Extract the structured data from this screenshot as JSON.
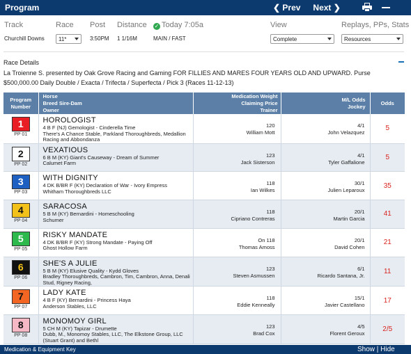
{
  "header": {
    "title": "Program",
    "prev": "❮ Prev",
    "next": "Next ❯",
    "print_icon": "printer-icon",
    "minimize_icon": "minus-icon"
  },
  "info": {
    "labels": {
      "track": "Track",
      "race": "Race",
      "post": "Post",
      "distance": "Distance",
      "today": "Today 7:05a",
      "view": "View",
      "replays": "Replays, PPs, Stats"
    },
    "track_value": "Churchill Downs",
    "race_value": "11*",
    "post_value": "3:50PM",
    "distance_value": "1 1/16M",
    "surface_value": "MAIN / FAST",
    "view_value": "Complete",
    "resources_value": "Resources"
  },
  "race_details": {
    "label": "Race Details",
    "description": "La Troienne S. presented by Oak Grove Racing and Gaming FOR FILLIES AND MARES FOUR YEARS OLD AND UPWARD. Purse $500,000.00 Daily Double / Exacta / Trifecta / Superfecta / Pick 3 (Races 11-12-13)"
  },
  "table": {
    "headers": {
      "program": [
        "Program",
        "Number"
      ],
      "horse": [
        "Horse",
        "Breed Sire-Dam",
        "Owner"
      ],
      "med": [
        "Medication Weight",
        "Claiming Price",
        "Trainer"
      ],
      "ml": [
        "M/L Odds",
        "Jockey"
      ],
      "odds": "Odds"
    },
    "rows": [
      {
        "num": "1",
        "pp": "PP 01",
        "bg": "#e81e24",
        "fg": "#ffffff",
        "name": "HOROLOGIST",
        "breed": "4 B F (NJ) Gemologist - Cinderella Time",
        "owner": "There's A Chance Stable, Parkland Thoroughbreds, Medallion Racing and Abbondanza",
        "med": "",
        "weight": "120",
        "trainer": "William Mott",
        "ml": "4/1",
        "jockey": "John Velazquez",
        "odds": "5"
      },
      {
        "num": "2",
        "pp": "PP 02",
        "bg": "#ffffff",
        "fg": "#111111",
        "name": "VEXATIOUS",
        "breed": "6 B M (KY) Giant's Causeway - Dream of Summer",
        "owner": "Calumet Farm",
        "med": "",
        "weight": "123",
        "trainer": "Jack Sisterson",
        "ml": "4/1",
        "jockey": "Tyler Gaffalione",
        "odds": "5"
      },
      {
        "num": "3",
        "pp": "PP 03",
        "bg": "#1e5fc2",
        "fg": "#ffffff",
        "name": "WITH DIGNITY",
        "breed": "4 DK B/BR F (KY) Declaration of War - Ivory Empress",
        "owner": "Whitham Thoroughbreds LLC",
        "med": "",
        "weight": "118",
        "trainer": "Ian Wilkes",
        "ml": "30/1",
        "jockey": "Julien Leparoux",
        "odds": "35"
      },
      {
        "num": "4",
        "pp": "PP 04",
        "bg": "#f3c21a",
        "fg": "#111111",
        "name": "SARACOSA",
        "breed": "5 B M (KY) Bernardini - Homeschooling",
        "owner": "Schumer",
        "med": "",
        "weight": "118",
        "trainer": "Cipriano Contreras",
        "ml": "20/1",
        "jockey": "Martin Garcia",
        "odds": "41"
      },
      {
        "num": "5",
        "pp": "PP 05",
        "bg": "#2eb94c",
        "fg": "#ffffff",
        "name": "RISKY MANDATE",
        "breed": "4 DK B/BR F (KY) Strong Mandate - Paying Off",
        "owner": "Ghost Hollow Farm",
        "med": "On",
        "weight": "118",
        "trainer": "Thomas Amoss",
        "ml": "20/1",
        "jockey": "David Cohen",
        "odds": "21"
      },
      {
        "num": "6",
        "pp": "PP 06",
        "bg": "#111111",
        "fg": "#f3c21a",
        "name": "SHE'S A JULIE",
        "breed": "5 B M (KY) Elusive Quality - Kydd Gloves",
        "owner": "Bradley Thoroughbreds, Cambron, Tim, Cambron, Anna, Denali Stud, Rigney Racing,",
        "med": "",
        "weight": "123",
        "trainer": "Steven Asmussen",
        "ml": "6/1",
        "jockey": "Ricardo Santana, Jr.",
        "odds": "11"
      },
      {
        "num": "7",
        "pp": "PP 07",
        "bg": "#f26522",
        "fg": "#111111",
        "name": "LADY KATE",
        "breed": "4 B F (KY) Bernardini - Princess Haya",
        "owner": "Anderson Stables, LLC",
        "med": "",
        "weight": "118",
        "trainer": "Eddie Kenneally",
        "ml": "15/1",
        "jockey": "Javier Castellano",
        "odds": "17"
      },
      {
        "num": "8",
        "pp": "PP 08",
        "bg": "#f6b8c4",
        "fg": "#111111",
        "name": "MONOMOY GIRL",
        "breed": "5 CH M (KY) Tapizar - Drumette",
        "owner": "Dubb, M., Monomoy Stables, LLC, The Elkstone Group, LLC (Stuart Grant) and Bethl",
        "med": "",
        "weight": "123",
        "trainer": "Brad Cox",
        "ml": "4/5",
        "jockey": "Florent Geroux",
        "odds": "2/5"
      }
    ]
  },
  "footer": {
    "key": "Medication & Equipment Key",
    "show_hide": "Show | Hide"
  }
}
